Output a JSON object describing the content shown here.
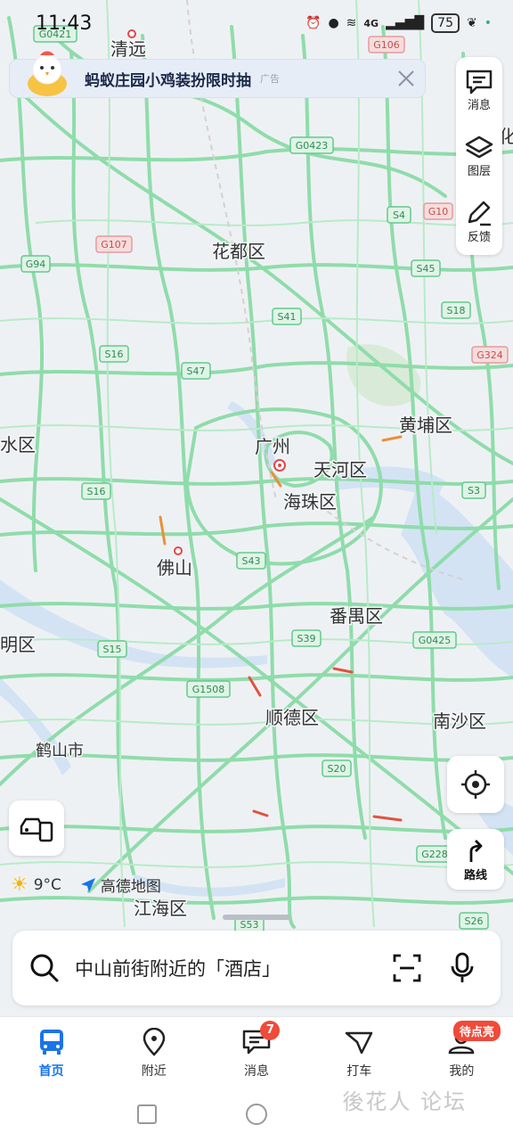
{
  "status_bar": {
    "time": "11:43",
    "battery": "75",
    "network": "4G"
  },
  "banner": {
    "title": "蚂蚁庄园小鸡装扮限时抽",
    "ad_label": "广告"
  },
  "side_panel": [
    {
      "label": "消息",
      "icon": "message-icon"
    },
    {
      "label": "图层",
      "icon": "layers-icon"
    },
    {
      "label": "反馈",
      "icon": "edit-icon"
    }
  ],
  "map": {
    "places": [
      {
        "name": "清远"
      },
      {
        "name": "花都区"
      },
      {
        "name": "广州"
      },
      {
        "name": "天河区"
      },
      {
        "name": "海珠区"
      },
      {
        "name": "黄埔区"
      },
      {
        "name": "佛山"
      },
      {
        "name": "番禺区"
      },
      {
        "name": "顺德区"
      },
      {
        "name": "南沙区"
      },
      {
        "name": "鹤山市"
      },
      {
        "name": "江海区"
      },
      {
        "name": "明区"
      },
      {
        "name": "水区"
      },
      {
        "name": "化"
      }
    ],
    "shields": [
      {
        "code": "G0421",
        "color": "green"
      },
      {
        "code": "G106",
        "color": "red"
      },
      {
        "code": "G0423",
        "color": "green"
      },
      {
        "code": "S4",
        "color": "green"
      },
      {
        "code": "G10",
        "color": "red"
      },
      {
        "code": "G107",
        "color": "red"
      },
      {
        "code": "G94",
        "color": "green"
      },
      {
        "code": "S45",
        "color": "green"
      },
      {
        "code": "S41",
        "color": "green"
      },
      {
        "code": "S18",
        "color": "green"
      },
      {
        "code": "S16",
        "color": "green"
      },
      {
        "code": "S47",
        "color": "green"
      },
      {
        "code": "G324",
        "color": "red"
      },
      {
        "code": "S16",
        "color": "green"
      },
      {
        "code": "S3",
        "color": "green"
      },
      {
        "code": "S43",
        "color": "green"
      },
      {
        "code": "S39",
        "color": "green"
      },
      {
        "code": "G0425",
        "color": "green"
      },
      {
        "code": "S15",
        "color": "green"
      },
      {
        "code": "G1508",
        "color": "green"
      },
      {
        "code": "S20",
        "color": "green"
      },
      {
        "code": "G228",
        "color": "green"
      },
      {
        "code": "S26",
        "color": "green"
      },
      {
        "code": "S53",
        "color": "green"
      }
    ]
  },
  "route_button": {
    "label": "路线"
  },
  "weather": {
    "temp": "9°C",
    "brand": "高德地图"
  },
  "search": {
    "placeholder": "中山前街附近的「酒店」"
  },
  "tabs": [
    {
      "label": "首页",
      "active": true
    },
    {
      "label": "附近"
    },
    {
      "label": "消息",
      "badge": "7"
    },
    {
      "label": "打车"
    },
    {
      "label": "我的",
      "badge": "待点亮"
    }
  ],
  "colors": {
    "accent": "#1a73e8",
    "road": "#86d9a8",
    "badge": "#f04a3a",
    "water": "#cfe0f2"
  },
  "watermark": "後花人 论坛"
}
